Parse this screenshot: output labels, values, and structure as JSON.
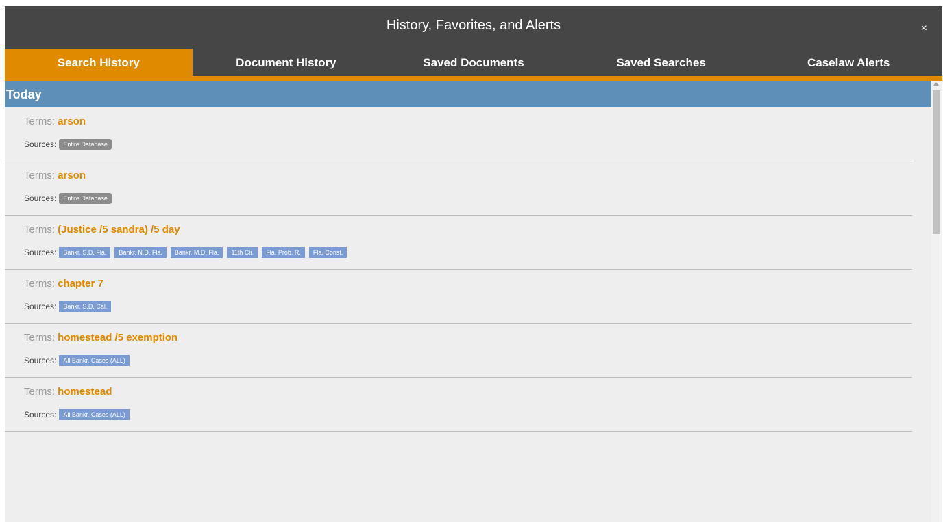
{
  "window": {
    "title": "History, Favorites, and Alerts",
    "close_label": "×"
  },
  "tabs": [
    {
      "label": "Search History",
      "active": true
    },
    {
      "label": "Document History",
      "active": false
    },
    {
      "label": "Saved Documents",
      "active": false
    },
    {
      "label": "Saved Searches",
      "active": false
    },
    {
      "label": "Caselaw Alerts",
      "active": false
    }
  ],
  "section": {
    "label": "Today"
  },
  "labels": {
    "terms": "Terms:",
    "sources": "Sources:"
  },
  "entries": [
    {
      "terms": "arson",
      "sources": [
        {
          "label": "Entire Database",
          "style": "gray"
        }
      ]
    },
    {
      "terms": "arson",
      "sources": [
        {
          "label": "Entire Database",
          "style": "gray"
        }
      ]
    },
    {
      "terms": "(Justice /5 sandra) /5 day",
      "sources": [
        {
          "label": "Bankr. S.D. Fla.",
          "style": "blue"
        },
        {
          "label": "Bankr. N.D. Fla.",
          "style": "blue"
        },
        {
          "label": "Bankr. M.D. Fla.",
          "style": "blue"
        },
        {
          "label": "11th Cir.",
          "style": "blue"
        },
        {
          "label": "Fla. Prob. R.",
          "style": "blue"
        },
        {
          "label": "Fla. Const.",
          "style": "blue"
        }
      ]
    },
    {
      "terms": "chapter 7",
      "sources": [
        {
          "label": "Bankr. S.D. Cal.",
          "style": "blue"
        }
      ]
    },
    {
      "terms": "homestead /5 exemption",
      "sources": [
        {
          "label": "All Bankr. Cases (ALL)",
          "style": "blue"
        }
      ]
    },
    {
      "terms": "homestead",
      "sources": [
        {
          "label": "All Bankr. Cases (ALL)",
          "style": "blue"
        }
      ]
    }
  ],
  "colors": {
    "accent": "#e08a00",
    "titlebar": "#464646",
    "section_header": "#5e8fb8",
    "chip_blue": "#7a9bd4",
    "chip_gray": "#8c8c8c"
  }
}
